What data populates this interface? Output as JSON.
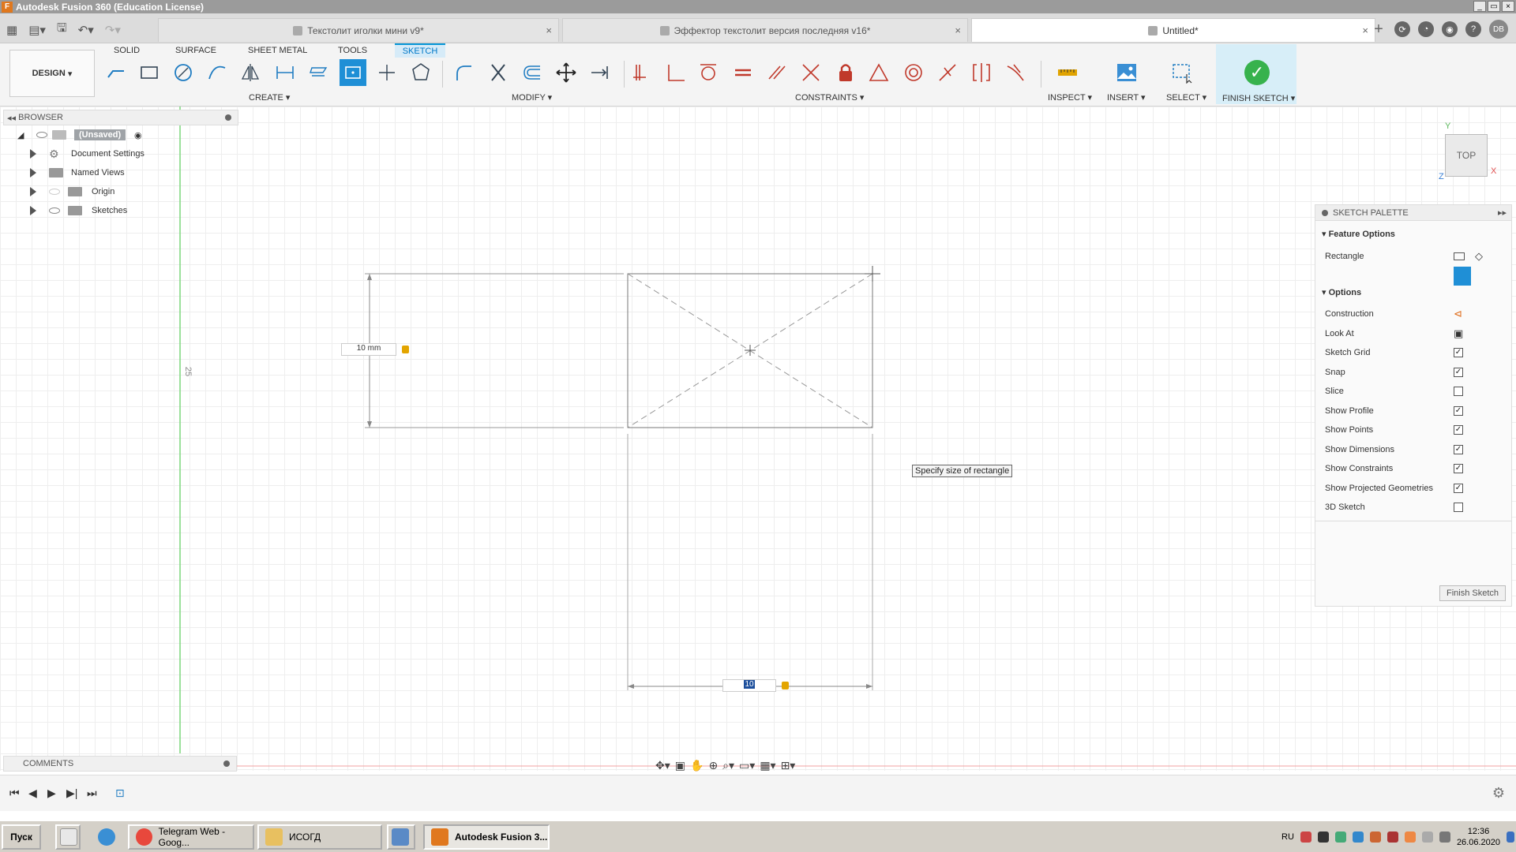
{
  "window": {
    "title": "Autodesk Fusion 360 (Education License)"
  },
  "tabs": [
    {
      "label": "Текстолит иголки мини v9*"
    },
    {
      "label": "Эффектор текстолит версия последняя v16*"
    },
    {
      "label": "Untitled*"
    }
  ],
  "user": {
    "initials": "DB"
  },
  "toolbar": {
    "workspace": "DESIGN",
    "workspace_tabs": [
      "SOLID",
      "SURFACE",
      "SHEET METAL",
      "TOOLS",
      "SKETCH"
    ],
    "groups": {
      "create": "CREATE",
      "modify": "MODIFY",
      "constraints": "CONSTRAINTS",
      "inspect": "INSPECT",
      "insert": "INSERT",
      "select": "SELECT",
      "finish": "FINISH SKETCH"
    }
  },
  "browser": {
    "header": "BROWSER",
    "root": "(Unsaved)",
    "items": [
      "Document Settings",
      "Named Views",
      "Origin",
      "Sketches"
    ]
  },
  "sketch": {
    "dim_vertical": "10 mm",
    "dim_horizontal": "10",
    "side_label": "25",
    "tooltip": "Specify size of rectangle"
  },
  "viewcube": {
    "face": "TOP",
    "axes": {
      "x": "X",
      "y": "Y",
      "z": "Z"
    }
  },
  "palette": {
    "header": "SKETCH PALETTE",
    "feature_options": "Feature Options",
    "rectangle_label": "Rectangle",
    "options": "Options",
    "rows": [
      {
        "label": "Construction",
        "type": "icon"
      },
      {
        "label": "Look At",
        "type": "icon"
      },
      {
        "label": "Sketch Grid",
        "checked": true
      },
      {
        "label": "Snap",
        "checked": true
      },
      {
        "label": "Slice",
        "checked": false
      },
      {
        "label": "Show Profile",
        "checked": true
      },
      {
        "label": "Show Points",
        "checked": true
      },
      {
        "label": "Show Dimensions",
        "checked": true
      },
      {
        "label": "Show Constraints",
        "checked": true
      },
      {
        "label": "Show Projected Geometries",
        "checked": true
      },
      {
        "label": "3D Sketch",
        "checked": false
      }
    ],
    "finish_button": "Finish Sketch"
  },
  "comments": {
    "label": "COMMENTS"
  },
  "taskbar": {
    "start": "Пуск",
    "apps": [
      "Telegram Web - Goog...",
      "ИСОГД",
      "Autodesk Fusion 3..."
    ],
    "lang": "RU",
    "time": "12:36",
    "date": "26.06.2020"
  },
  "colors": {
    "accent": "#0696d7",
    "finish_green": "#37b24d",
    "lock": "#e3a500",
    "titlebar": "#9b9b9b"
  }
}
